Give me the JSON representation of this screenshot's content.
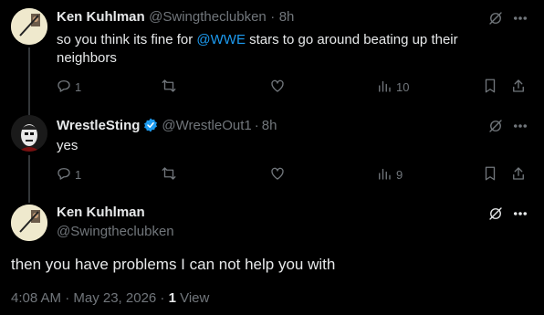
{
  "tweets": [
    {
      "name": "Ken Kuhlman",
      "handle": "@Swingtheclubken",
      "sep": "·",
      "time": "8h",
      "text_before": "so you think its fine for ",
      "mention": "@WWE",
      "text_after": " stars to go around beating up their neighbors",
      "replies": "1",
      "views": "10"
    },
    {
      "name": "WrestleSting",
      "handle": "@WrestleOut1",
      "sep": "·",
      "time": "8h",
      "text": "yes",
      "replies": "1",
      "views": "9"
    }
  ],
  "main": {
    "name": "Ken Kuhlman",
    "handle": "@Swingtheclubken",
    "text": "then you have problems I can not help you with",
    "timestamp": "4:08 AM · May 23, 2026 · ",
    "views_count": "1",
    "views_label": " View"
  },
  "icons": [
    "grok-icon",
    "more-icon",
    "reply-icon",
    "retweet-icon",
    "like-icon",
    "views-icon",
    "bookmark-icon",
    "share-icon",
    "verified-badge-icon"
  ],
  "colors": {
    "background": "#000000",
    "text": "#e7e9ea",
    "muted": "#71767b",
    "link": "#1d9bf0",
    "verified": "#1d9bf0"
  }
}
